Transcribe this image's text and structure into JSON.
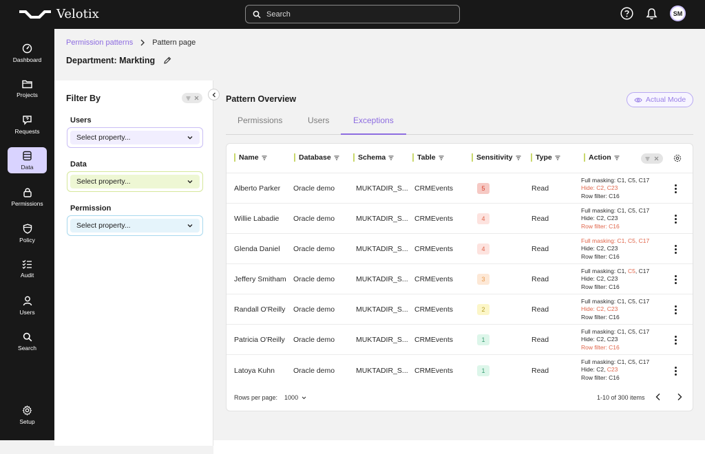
{
  "app": {
    "name": "Velotix"
  },
  "search": {
    "placeholder": "Search"
  },
  "user": {
    "initials": "SM"
  },
  "nav": [
    {
      "label": "Dashboard",
      "icon": "dashboard-icon"
    },
    {
      "label": "Projects",
      "icon": "folder-icon"
    },
    {
      "label": "Requests",
      "icon": "requests-icon"
    },
    {
      "label": "Data",
      "icon": "database-icon",
      "active": true
    },
    {
      "label": "Permissions",
      "icon": "lock-icon"
    },
    {
      "label": "Policy",
      "icon": "shield-icon"
    },
    {
      "label": "Audit",
      "icon": "checklist-icon"
    },
    {
      "label": "Users",
      "icon": "user-icon"
    },
    {
      "label": "Search",
      "icon": "search-icon"
    },
    {
      "label": "Setup",
      "icon": "gear-icon"
    }
  ],
  "breadcrumb": {
    "parent": "Permission patterns",
    "current": "Pattern page"
  },
  "department": {
    "title": "Department: Markting"
  },
  "filter": {
    "title": "Filter By",
    "groups": [
      {
        "label": "Users",
        "placeholder": "Select property...",
        "border": "#c9bdf5",
        "fill": "#f1eefe"
      },
      {
        "label": "Data",
        "placeholder": "Select property...",
        "border": "#d5e89a",
        "fill": "#eef7d4"
      },
      {
        "label": "Permission",
        "placeholder": "Select property...",
        "border": "#a8d8ee",
        "fill": "#e5f4fb"
      }
    ]
  },
  "overview": {
    "title": "Pattern Overview",
    "mode_button": "Actual Mode"
  },
  "tabs": [
    {
      "label": "Permissions"
    },
    {
      "label": "Users"
    },
    {
      "label": "Exceptions",
      "active": true
    }
  ],
  "table": {
    "columns": [
      "Name",
      "Database",
      "Schema",
      "Table",
      "Sensitivity",
      "Type",
      "Action"
    ],
    "rows": [
      {
        "name": "Alberto Parker",
        "database": "Oracle demo",
        "schema": "MUKTADIR_S...",
        "table": "CRMEvents",
        "sensitivity": "5",
        "type": "Read",
        "action": [
          [
            [
              "Full masking: C1, C5, C17",
              false
            ]
          ],
          [
            [
              "Hide: C2, C23",
              true
            ]
          ],
          [
            [
              "Row filter: C16",
              false
            ]
          ]
        ]
      },
      {
        "name": "Willie Labadie",
        "database": "Oracle demo",
        "schema": "MUKTADIR_S...",
        "table": "CRMEvents",
        "sensitivity": "4",
        "type": "Read",
        "action": [
          [
            [
              "Full masking: C1, C5, C17",
              false
            ]
          ],
          [
            [
              "Hide: C2, C23",
              false
            ]
          ],
          [
            [
              "Row filter: C16",
              true
            ]
          ]
        ]
      },
      {
        "name": "Glenda Daniel",
        "database": "Oracle demo",
        "schema": "MUKTADIR_S...",
        "table": "CRMEvents",
        "sensitivity": "4",
        "type": "Read",
        "action": [
          [
            [
              "Full masking: C1, C5, C17",
              true
            ]
          ],
          [
            [
              "Hide: C2, C23",
              false
            ]
          ],
          [
            [
              "Row filter: C16",
              false
            ]
          ]
        ]
      },
      {
        "name": "Jeffery Smitham",
        "database": "Oracle demo",
        "schema": "MUKTADIR_S...",
        "table": "CRMEvents",
        "sensitivity": "3",
        "type": "Read",
        "action": [
          [
            [
              "Full masking: C1, ",
              false
            ],
            [
              "C5",
              true
            ],
            [
              ", C17",
              false
            ]
          ],
          [
            [
              "Hide: C2, C23",
              false
            ]
          ],
          [
            [
              "Row filter: C16",
              false
            ]
          ]
        ]
      },
      {
        "name": "Randall O'Reilly",
        "database": "Oracle demo",
        "schema": "MUKTADIR_S...",
        "table": "CRMEvents",
        "sensitivity": "2",
        "type": "Read",
        "action": [
          [
            [
              "Full masking: C1, C5, C17",
              false
            ]
          ],
          [
            [
              "Hide: C2, C23",
              true
            ]
          ],
          [
            [
              "Row filter: C16",
              false
            ]
          ]
        ]
      },
      {
        "name": "Patricia O'Reilly",
        "database": "Oracle demo",
        "schema": "MUKTADIR_S...",
        "table": "CRMEvents",
        "sensitivity": "1",
        "type": "Read",
        "action": [
          [
            [
              "Full masking: C1, C5, C17",
              false
            ]
          ],
          [
            [
              "Hide: C2, C23",
              false
            ]
          ],
          [
            [
              "Row filter: C16",
              true
            ]
          ]
        ]
      },
      {
        "name": "Latoya Kuhn",
        "database": "Oracle demo",
        "schema": "MUKTADIR_S...",
        "table": "CRMEvents",
        "sensitivity": "1",
        "type": "Read",
        "action": [
          [
            [
              "Full masking: C1, C5, C17",
              false
            ]
          ],
          [
            [
              "Hide: C2, ",
              false
            ],
            [
              "C23",
              true
            ]
          ],
          [
            [
              "Row filter: C16",
              false
            ]
          ]
        ]
      }
    ]
  },
  "sensitivity_colors": {
    "5": {
      "bg": "#f6c9c4",
      "fg": "#d8402c"
    },
    "4": {
      "bg": "#fde3df",
      "fg": "#e0654a"
    },
    "3": {
      "bg": "#fde8d6",
      "fg": "#e89a4c"
    },
    "2": {
      "bg": "#fcf6c8",
      "fg": "#b8a02a"
    },
    "1": {
      "bg": "#ddf6ea",
      "fg": "#3a9f74"
    }
  },
  "pagination": {
    "rows_per_page_label": "Rows per page:",
    "rows_per_page": "1000",
    "range": "1-10 of 300 items"
  },
  "colors": {
    "accent": "#8d6ce0",
    "highlight": "#e0654a",
    "topbar": "#181818"
  }
}
